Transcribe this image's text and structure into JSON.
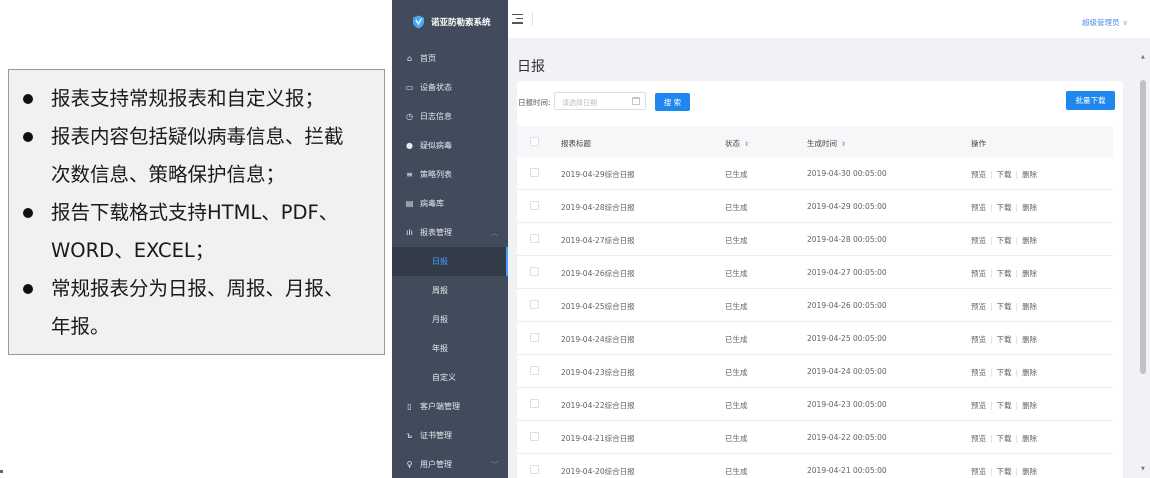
{
  "annotation": {
    "bullets": [
      "报表支持常规报表和自定义报；",
      "报表内容包括疑似病毒信息、拦截",
      "次数信息、策略保护信息；",
      "报告下载格式支持HTML、PDF、",
      "WORD、EXCEL；",
      "常规报表分为日报、周报、月报、",
      "年报。"
    ]
  },
  "app": {
    "brand": "诺亚防勒索系统",
    "admin_label": "超级管理员",
    "admin_caret": "∨",
    "menu": [
      {
        "label": "首页",
        "icon": "⌂",
        "icon_name": "home-icon"
      },
      {
        "label": "设备状态",
        "icon": "▭",
        "icon_name": "monitor-icon"
      },
      {
        "label": "日志信息",
        "icon": "◷",
        "icon_name": "clock-icon"
      },
      {
        "label": "疑似病毒",
        "icon": "●",
        "icon_name": "alert-icon"
      },
      {
        "label": "策略列表",
        "icon": "≡",
        "icon_name": "list-icon"
      },
      {
        "label": "病毒库",
        "icon": "▤",
        "icon_name": "database-icon"
      },
      {
        "label": "报表管理",
        "icon": "ılı",
        "icon_name": "chart-icon"
      }
    ],
    "submenu": [
      "日报",
      "周报",
      "月报",
      "年报",
      "自定义"
    ],
    "menu_bottom": [
      {
        "label": "客户端管理",
        "icon": "▯",
        "icon_name": "phone-icon"
      },
      {
        "label": "证书管理",
        "icon": "ъ",
        "icon_name": "certificate-icon"
      },
      {
        "label": "用户管理",
        "icon": "♀",
        "icon_name": "user-icon"
      }
    ],
    "page_title": "日报",
    "filter": {
      "label": "日报时间:",
      "placeholder": "请选择日期",
      "search_button": "搜 索",
      "batch_button": "批量下载"
    },
    "table": {
      "headers": {
        "title": "报表标题",
        "status": "状态",
        "time": "生成时间",
        "ops": "操作",
        "sort_icon": "⬍"
      },
      "ops": [
        "预览",
        "下载",
        "删除"
      ],
      "rows": [
        {
          "title": "2019-04-29综合日报",
          "status": "已生成",
          "time": "2019-04-30 00:05:00"
        },
        {
          "title": "2019-04-28综合日报",
          "status": "已生成",
          "time": "2019-04-29 00:05:00"
        },
        {
          "title": "2019-04-27综合日报",
          "status": "已生成",
          "time": "2019-04-28 00:05:00"
        },
        {
          "title": "2019-04-26综合日报",
          "status": "已生成",
          "time": "2019-04-27 00:05:00"
        },
        {
          "title": "2019-04-25综合日报",
          "status": "已生成",
          "time": "2019-04-26 00:05:00"
        },
        {
          "title": "2019-04-24综合日报",
          "status": "已生成",
          "time": "2019-04-25 00:05:00"
        },
        {
          "title": "2019-04-23综合日报",
          "status": "已生成",
          "time": "2019-04-24 00:05:00"
        },
        {
          "title": "2019-04-22综合日报",
          "status": "已生成",
          "time": "2019-04-23 00:05:00"
        },
        {
          "title": "2019-04-21综合日报",
          "status": "已生成",
          "time": "2019-04-22 00:05:00"
        },
        {
          "title": "2019-04-20综合日报",
          "status": "已生成",
          "time": "2019-04-21 00:05:00"
        }
      ]
    }
  },
  "colors": {
    "sidebar": "#414b5c",
    "sidebar_active": "#333b49",
    "accent": "#1e87f0",
    "link": "#4a90e2"
  }
}
